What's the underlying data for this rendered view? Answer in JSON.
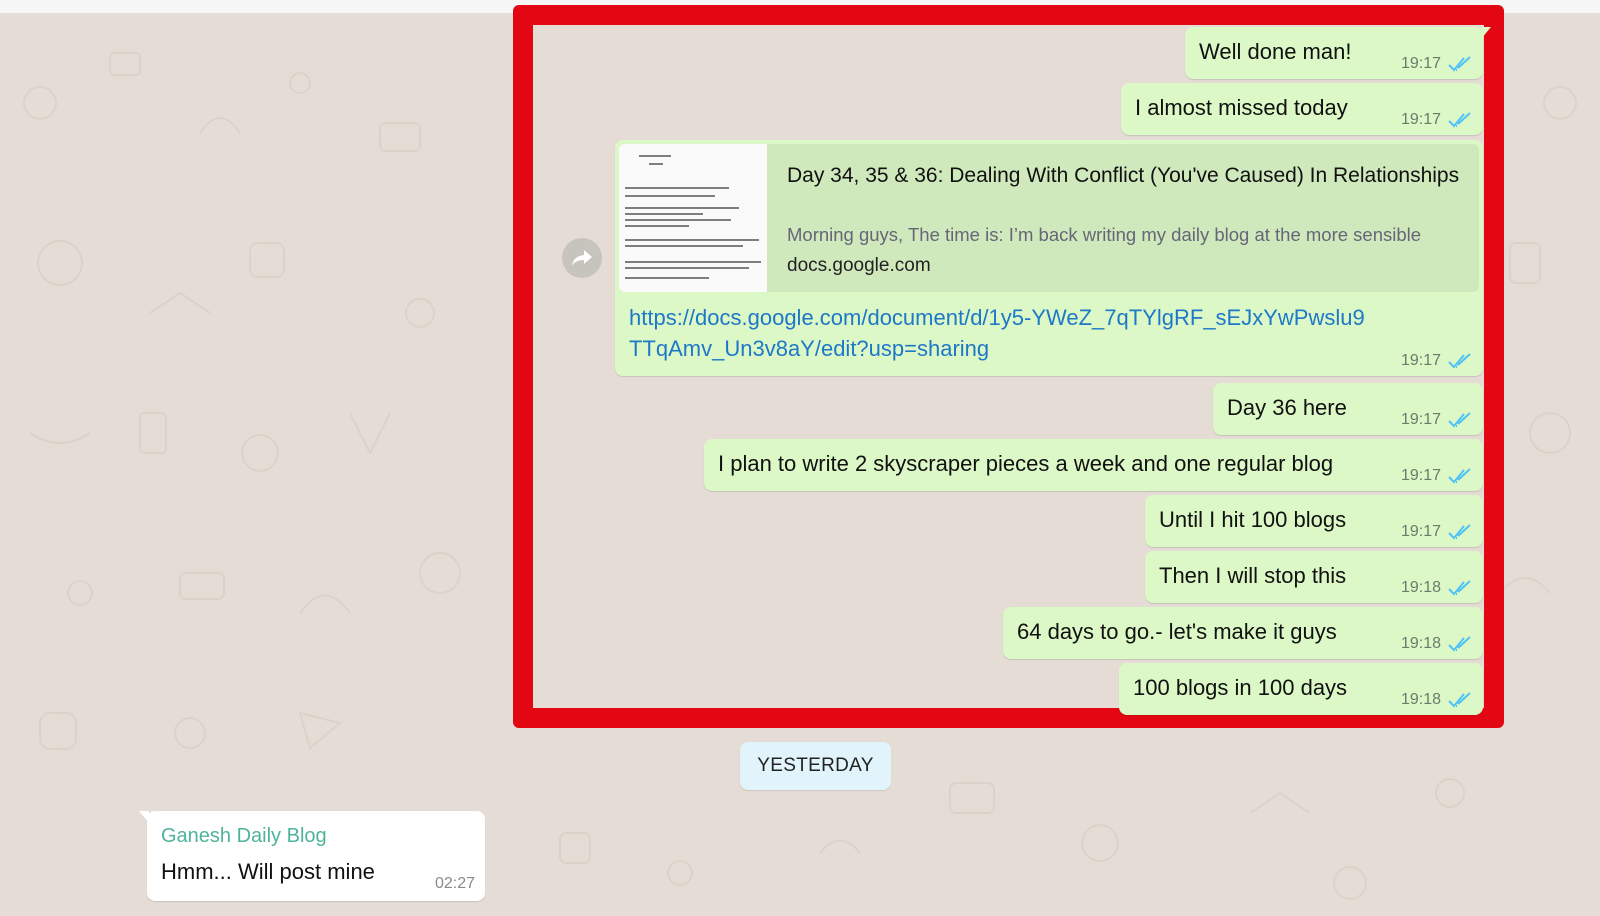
{
  "outgoing_messages": [
    {
      "text": "Well done man!",
      "time": "19:17"
    },
    {
      "text": "I almost missed today",
      "time": "19:17"
    },
    {
      "text": "Day 36 here",
      "time": "19:17"
    },
    {
      "text": "I plan to write 2 skyscraper pieces a week and one regular blog",
      "time": "19:17"
    },
    {
      "text": "Until I hit 100 blogs",
      "time": "19:17"
    },
    {
      "text": "Then I will stop this",
      "time": "19:18"
    },
    {
      "text": "64 days to go.- let's make it guys",
      "time": "19:18"
    },
    {
      "text": "100 blogs in 100 days",
      "time": "19:18"
    }
  ],
  "link_message": {
    "preview_title": "Day 34, 35 & 36: Dealing With Conflict (You've Caused) In Relationships",
    "preview_description": "Morning guys, The time is: I’m back writing my daily blog at the more sensible",
    "preview_domain": "docs.google.com",
    "url": "https://docs.google.com/document/d/1y5-YWeZ_7qTYlgRF_sEJxYwPwslu9TTqAmv_Un3v8aY/edit?usp=sharing",
    "time": "19:17"
  },
  "date_divider": "YESTERDAY",
  "incoming_message": {
    "sender": "Ganesh Daily Blog",
    "text": "Hmm... Will post mine",
    "time": "02:27"
  },
  "colors": {
    "highlight": "#e30613",
    "outgoing_bubble": "#dcf8c6",
    "read_ticks": "#4fc3f7",
    "sender_name": "#4fb39c",
    "link": "#1e78c8"
  },
  "icons": {
    "read_receipt": "double-check-icon",
    "forward": "forward-arrow-icon"
  }
}
